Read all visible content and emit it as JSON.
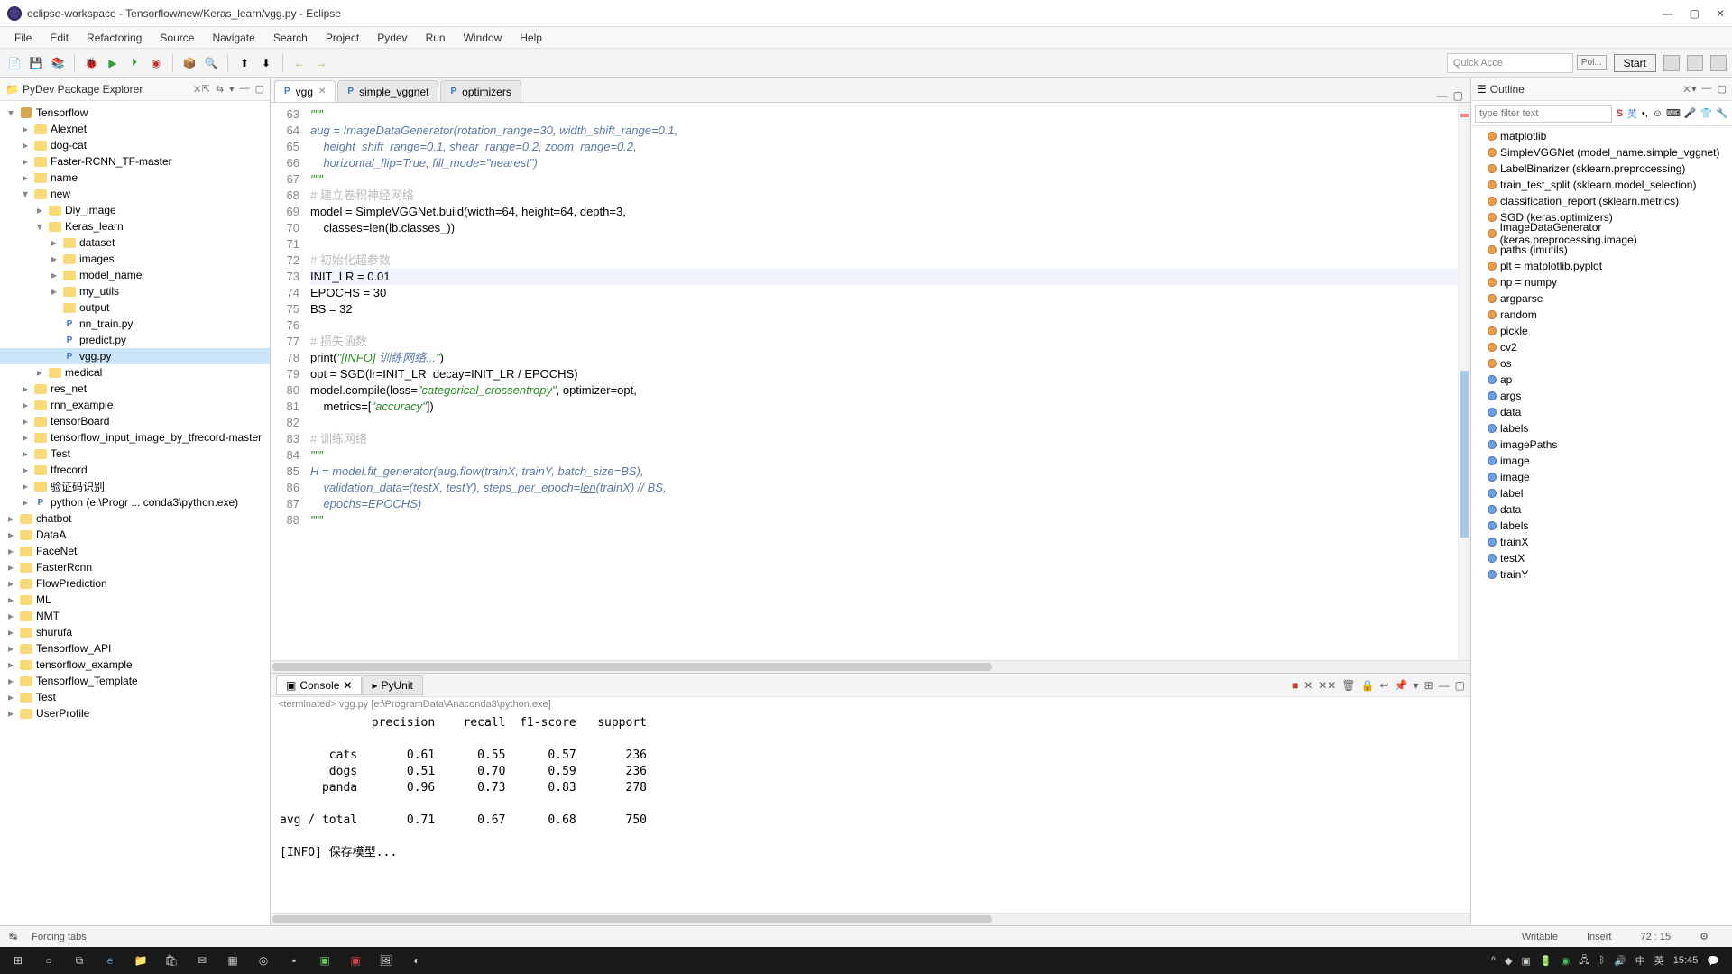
{
  "window": {
    "title": "eclipse-workspace - Tensorflow/new/Keras_learn/vgg.py - Eclipse"
  },
  "menu": [
    "File",
    "Edit",
    "Refactoring",
    "Source",
    "Navigate",
    "Search",
    "Project",
    "Pydev",
    "Run",
    "Window",
    "Help"
  ],
  "toolbar": {
    "quick_access_placeholder": "Quick Acce",
    "start_label": "Start",
    "pol_label": "Pol..."
  },
  "package_explorer": {
    "title": "PyDev Package Explorer"
  },
  "tree": [
    {
      "d": 0,
      "ex": "-",
      "icon": "proj",
      "label": "Tensorflow"
    },
    {
      "d": 1,
      "ex": ">",
      "icon": "folder",
      "label": "Alexnet"
    },
    {
      "d": 1,
      "ex": ">",
      "icon": "folder",
      "label": "dog-cat"
    },
    {
      "d": 1,
      "ex": ">",
      "icon": "folder",
      "label": "Faster-RCNN_TF-master"
    },
    {
      "d": 1,
      "ex": ">",
      "icon": "folder",
      "label": "name"
    },
    {
      "d": 1,
      "ex": "-",
      "icon": "folder",
      "label": "new"
    },
    {
      "d": 2,
      "ex": ">",
      "icon": "folder",
      "label": "Diy_image"
    },
    {
      "d": 2,
      "ex": "-",
      "icon": "folder",
      "label": "Keras_learn"
    },
    {
      "d": 3,
      "ex": ">",
      "icon": "folder",
      "label": "dataset"
    },
    {
      "d": 3,
      "ex": ">",
      "icon": "folder",
      "label": "images"
    },
    {
      "d": 3,
      "ex": ">",
      "icon": "folder",
      "label": "model_name"
    },
    {
      "d": 3,
      "ex": ">",
      "icon": "folder",
      "label": "my_utils"
    },
    {
      "d": 3,
      "ex": "",
      "icon": "folder",
      "label": "output"
    },
    {
      "d": 3,
      "ex": "",
      "icon": "py",
      "label": "nn_train.py"
    },
    {
      "d": 3,
      "ex": "",
      "icon": "py",
      "label": "predict.py"
    },
    {
      "d": 3,
      "ex": "",
      "icon": "py",
      "label": "vgg.py",
      "selected": true
    },
    {
      "d": 2,
      "ex": ">",
      "icon": "folder",
      "label": "medical"
    },
    {
      "d": 1,
      "ex": ">",
      "icon": "folder",
      "label": "res_net"
    },
    {
      "d": 1,
      "ex": ">",
      "icon": "folder",
      "label": "rnn_example"
    },
    {
      "d": 1,
      "ex": ">",
      "icon": "folder",
      "label": "tensorBoard"
    },
    {
      "d": 1,
      "ex": ">",
      "icon": "folder",
      "label": "tensorflow_input_image_by_tfrecord-master"
    },
    {
      "d": 1,
      "ex": ">",
      "icon": "folder",
      "label": "Test"
    },
    {
      "d": 1,
      "ex": ">",
      "icon": "folder",
      "label": "tfrecord"
    },
    {
      "d": 1,
      "ex": ">",
      "icon": "folder",
      "label": "验证码识别"
    },
    {
      "d": 1,
      "ex": ">",
      "icon": "py",
      "label": "python  (e:\\Progr ... conda3\\python.exe)"
    },
    {
      "d": 0,
      "ex": ">",
      "icon": "folder",
      "label": "chatbot"
    },
    {
      "d": 0,
      "ex": ">",
      "icon": "folder",
      "label": "DataA"
    },
    {
      "d": 0,
      "ex": ">",
      "icon": "folder",
      "label": "FaceNet"
    },
    {
      "d": 0,
      "ex": ">",
      "icon": "folder",
      "label": "FasterRcnn"
    },
    {
      "d": 0,
      "ex": ">",
      "icon": "folder",
      "label": "FlowPrediction"
    },
    {
      "d": 0,
      "ex": ">",
      "icon": "folder",
      "label": "ML"
    },
    {
      "d": 0,
      "ex": ">",
      "icon": "folder",
      "label": "NMT"
    },
    {
      "d": 0,
      "ex": ">",
      "icon": "folder",
      "label": "shurufa"
    },
    {
      "d": 0,
      "ex": ">",
      "icon": "folder",
      "label": "Tensorflow_API"
    },
    {
      "d": 0,
      "ex": ">",
      "icon": "folder",
      "label": "tensorflow_example"
    },
    {
      "d": 0,
      "ex": ">",
      "icon": "folder",
      "label": "Tensorflow_Template"
    },
    {
      "d": 0,
      "ex": ">",
      "icon": "folder",
      "label": "Test"
    },
    {
      "d": 0,
      "ex": ">",
      "icon": "folder",
      "label": "UserProfile"
    }
  ],
  "editor_tabs": [
    {
      "label": "vgg",
      "active": true
    },
    {
      "label": "simple_vggnet",
      "active": false
    },
    {
      "label": "optimizers",
      "active": false
    }
  ],
  "code_start_line": 63,
  "code_lines": [
    {
      "html": "<span class='str'>\"\"\"</span>"
    },
    {
      "html": "<span class='ital'>aug = ImageDataGenerator(rotation_range=30, width_shift_range=0.1,</span>"
    },
    {
      "html": "    <span class='ital'>height_shift_range=0.1, shear_range=0.2, zoom_range=0.2,</span>"
    },
    {
      "html": "    <span class='ital'>horizontal_flip=True, fill_mode=\"nearest\")</span>"
    },
    {
      "html": "<span class='str'>\"\"\"</span>"
    },
    {
      "html": "<span class='cmt'># 建立卷积神经网络</span>"
    },
    {
      "html": "model = SimpleVGGNet.build(width=<span class='num'>64</span>, height=<span class='num'>64</span>, depth=<span class='num'>3</span>,"
    },
    {
      "html": "    classes=len(lb.classes_))"
    },
    {
      "html": ""
    },
    {
      "html": "<span class='cmt'># 初始化超参数</span>"
    },
    {
      "html": "INIT_LR = <span class='num'>0.01</span>",
      "current": true
    },
    {
      "html": "EPOCHS = <span class='num'>30</span>"
    },
    {
      "html": "BS = <span class='num'>32</span>"
    },
    {
      "html": ""
    },
    {
      "html": "<span class='cmt'># 损失函数</span>"
    },
    {
      "html": "print(<span class='str'>\"[INFO] <span class='ital'>训练网络...</span>\"</span>)"
    },
    {
      "html": "opt = SGD(lr=INIT_LR, decay=INIT_LR / EPOCHS)"
    },
    {
      "html": "model.compile(loss=<span class='str'>\"categorical_crossentropy\"</span>, optimizer=opt,"
    },
    {
      "html": "    metrics=[<span class='str'>\"accuracy\"</span>])"
    },
    {
      "html": ""
    },
    {
      "html": "<span class='cmt'># 训练网络</span>"
    },
    {
      "html": "<span class='str'>\"\"\"</span>"
    },
    {
      "html": "<span class='ital'>H = model.fit_generator(aug.flow(trainX, trainY, batch_size=BS),</span>"
    },
    {
      "html": "    <span class='ital'>validation_data=(testX, testY), steps_per_epoch=<u>len</u>(trainX) // BS,</span>"
    },
    {
      "html": "    <span class='ital'>epochs=EPOCHS)</span>"
    },
    {
      "html": "<span class='str'>\"\"\"</span>"
    }
  ],
  "outline": {
    "title": "Outline",
    "filter_placeholder": "type filter text",
    "items": [
      {
        "label": "matplotlib",
        "c": "orange"
      },
      {
        "label": "SimpleVGGNet (model_name.simple_vggnet)",
        "c": "orange"
      },
      {
        "label": "LabelBinarizer (sklearn.preprocessing)",
        "c": "orange"
      },
      {
        "label": "train_test_split (sklearn.model_selection)",
        "c": "orange"
      },
      {
        "label": "classification_report (sklearn.metrics)",
        "c": "orange"
      },
      {
        "label": "SGD (keras.optimizers)",
        "c": "orange"
      },
      {
        "label": "ImageDataGenerator (keras.preprocessing.image)",
        "c": "orange"
      },
      {
        "label": "paths (imutils)",
        "c": "orange"
      },
      {
        "label": "plt = matplotlib.pyplot",
        "c": "orange"
      },
      {
        "label": "np = numpy",
        "c": "orange"
      },
      {
        "label": "argparse",
        "c": "orange"
      },
      {
        "label": "random",
        "c": "orange"
      },
      {
        "label": "pickle",
        "c": "orange"
      },
      {
        "label": "cv2",
        "c": "orange"
      },
      {
        "label": "os",
        "c": "orange"
      },
      {
        "label": "ap",
        "c": "blue"
      },
      {
        "label": "args",
        "c": "blue"
      },
      {
        "label": "data",
        "c": "blue"
      },
      {
        "label": "labels",
        "c": "blue"
      },
      {
        "label": "imagePaths",
        "c": "blue"
      },
      {
        "label": "image",
        "c": "blue"
      },
      {
        "label": "image",
        "c": "blue"
      },
      {
        "label": "label",
        "c": "blue"
      },
      {
        "label": "data",
        "c": "blue"
      },
      {
        "label": "labels",
        "c": "blue"
      },
      {
        "label": "trainX",
        "c": "blue"
      },
      {
        "label": "testX",
        "c": "blue"
      },
      {
        "label": "trainY",
        "c": "blue"
      }
    ]
  },
  "console": {
    "tab_console": "Console",
    "tab_pyunit": "PyUnit",
    "status": "<terminated> vgg.py [e:\\ProgramData\\Anaconda3\\python.exe]",
    "output": "             precision    recall  f1-score   support\n\n       cats       0.61      0.55      0.57       236\n       dogs       0.51      0.70      0.59       236\n      panda       0.96      0.73      0.83       278\n\navg / total       0.71      0.67      0.68       750\n\n[INFO] 保存模型..."
  },
  "statusbar": {
    "forcing": "Forcing tabs",
    "writable": "Writable",
    "insert": "Insert",
    "pos": "72 : 15"
  },
  "taskbar": {
    "time": "15:45",
    "ime1": "中",
    "ime2": "英"
  }
}
